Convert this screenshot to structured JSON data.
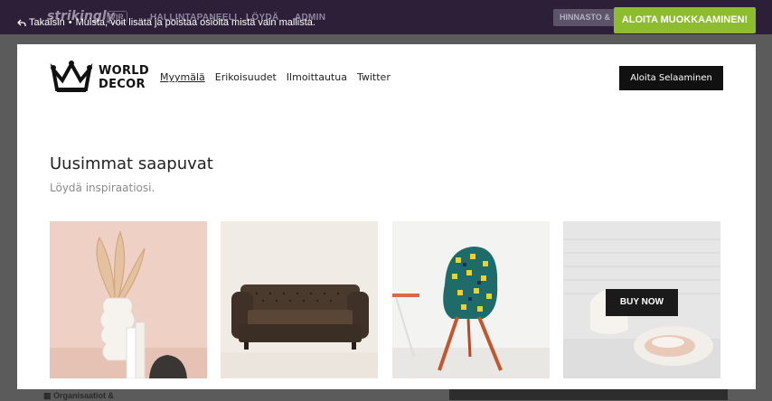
{
  "topbar": {
    "brand": "strikingly",
    "badge": "VIP",
    "nav": [
      "HALLINTAPANEELI",
      "LÖYDÄ",
      "ADMIN"
    ],
    "pricing_label": "HINNASTO &",
    "back_label": "Takaisin",
    "separator": "•",
    "notice": "Muista, voit lisätä ja poistaa osioita mistä vain mallista.",
    "edit_button": "ALOITA MUOKKAAMINEN!"
  },
  "background": {
    "sidebar_item": "Organisaatiot &"
  },
  "site": {
    "logo_line1": "WORLD",
    "logo_line2": "DECOR",
    "nav": [
      "Myymälä",
      "Erikoisuudet",
      "Ilmoittautua",
      "Twitter"
    ],
    "cta": "Aloita Selaaminen",
    "section_title": "Uusimmat saapuvat",
    "section_subtitle": "Löydä inspiraatiosi.",
    "products": [
      {
        "name": "vase-and-palm",
        "overlay": ""
      },
      {
        "name": "leather-sofa",
        "overlay": ""
      },
      {
        "name": "patterned-chair",
        "overlay": ""
      },
      {
        "name": "white-chairs",
        "overlay": "BUY NOW"
      }
    ]
  },
  "colors": {
    "topbar": "#3b2a4a",
    "edit_button": "#8dbd2e",
    "cta": "#111111"
  }
}
